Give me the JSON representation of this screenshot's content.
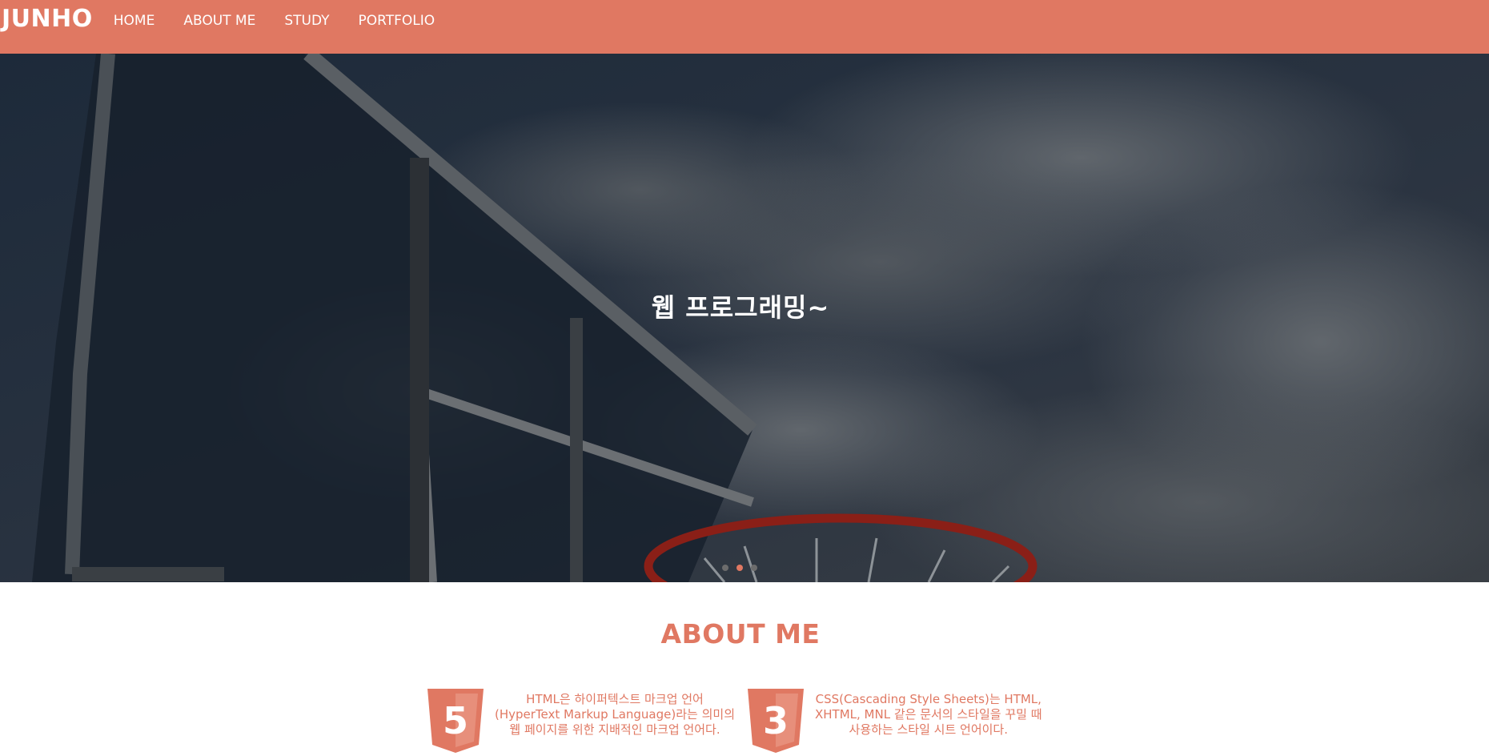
{
  "navbar": {
    "brand": "JUNHO",
    "links": [
      "HOME",
      "ABOUT ME",
      "STUDY",
      "PORTFOLIO"
    ],
    "background_color": "#e07862"
  },
  "hero": {
    "title": "웹 프로그래밍~",
    "carousel": {
      "slide_count": 3,
      "active_index": 1
    }
  },
  "about": {
    "title": "ABOUT ME",
    "skills": [
      {
        "icon": "html5-icon",
        "badge": "5",
        "lines": [
          "HTML은 하이퍼텍스트 마크업 언어",
          "(HyperText Markup Language)라는 의미의",
          "웹 페이지를 위한 지배적인 마크업 언어다."
        ]
      },
      {
        "icon": "css3-icon",
        "badge": "3",
        "lines": [
          "CSS(Cascading Style Sheets)는 HTML,",
          "XHTML, MNL 같은 문서의 스타일을 꾸밀 때",
          "사용하는 스타일 시트 언어이다."
        ]
      }
    ]
  },
  "colors": {
    "accent": "#e07862",
    "hero_overlay": "#2e3338"
  }
}
